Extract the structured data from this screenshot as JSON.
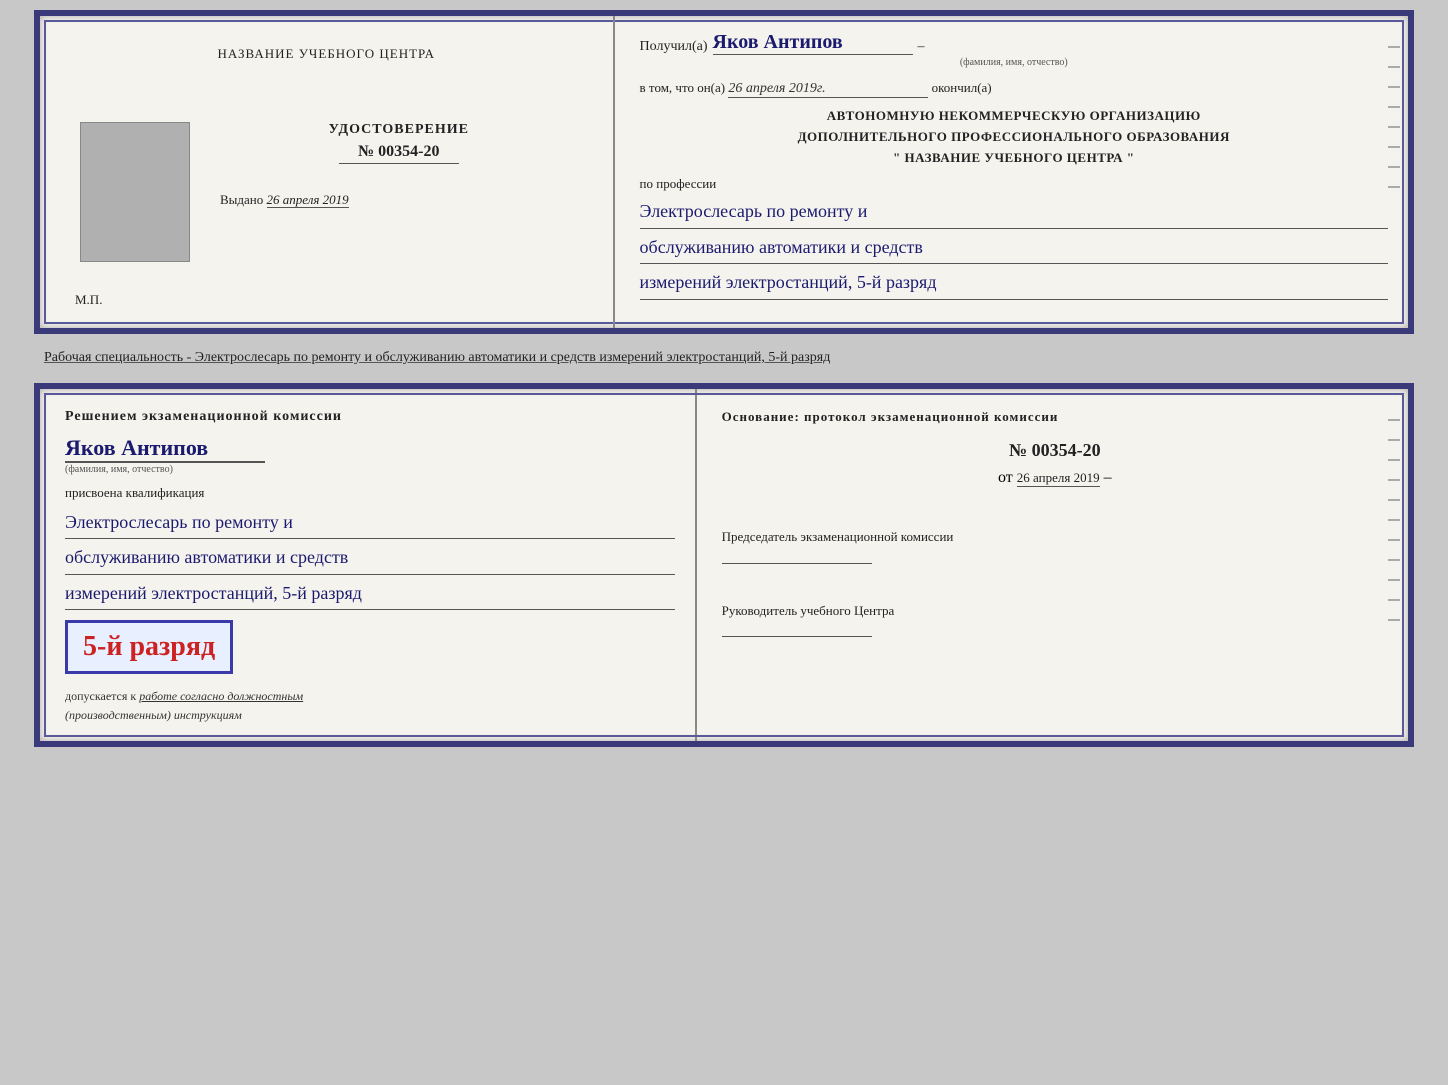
{
  "top": {
    "left": {
      "center_title": "НАЗВАНИЕ УЧЕБНОГО ЦЕНТРА",
      "udostoverenie_label": "УДОСТОВЕРЕНИЕ",
      "number": "№ 00354-20",
      "vydano_label": "Выдано",
      "vydano_date": "26 апреля 2019",
      "mp": "М.П."
    },
    "right": {
      "poluchil_prefix": "Получил(а)",
      "fio_handwritten": "Яков Антипов",
      "fio_sub": "(фамилия, имя, отчество)",
      "vtom_prefix": "в том, что он(а)",
      "vtom_date": "26 апреля 2019г.",
      "okkonchil": "окончил(а)",
      "org_line1": "АВТОНОМНУЮ НЕКОММЕРЧЕСКУЮ ОРГАНИЗАЦИЮ",
      "org_line2": "ДОПОЛНИТЕЛЬНОГО ПРОФЕССИОНАЛЬНОГО ОБРАЗОВАНИЯ",
      "org_line3": "\"  НАЗВАНИЕ УЧЕБНОГО ЦЕНТРА  \"",
      "po_professii": "по профессии",
      "profession_line1": "Электрослесарь по ремонту и",
      "profession_line2": "обслуживанию автоматики и средств",
      "profession_line3": "измерений электростанций, 5-й разряд"
    }
  },
  "middle_text": "Рабочая специальность - Электрослесарь по ремонту и обслуживанию автоматики и средств измерений электростанций, 5-й разряд",
  "bottom": {
    "left": {
      "resheniem_title": "Решением  экзаменационной  комиссии",
      "fio_handwritten": "Яков Антипов",
      "fio_sub": "(фамилия, имя, отчество)",
      "prisvoena_label": "присвоена квалификация",
      "profession_line1": "Электрослесарь по ремонту и",
      "profession_line2": "обслуживанию автоматики и средств",
      "profession_line3": "измерений электростанций, 5-й разряд",
      "grade_badge": "5-й разряд",
      "dopuskaetsya": "допускается к",
      "dopuskaetsya_underline": "работе согласно должностным",
      "dopuskaetsya2": "(производственным) инструкциям"
    },
    "right": {
      "osnovanie_label": "Основание: протокол  экзаменационной  комиссии",
      "number": "№  00354-20",
      "ot_prefix": "от",
      "ot_date": "26 апреля 2019",
      "predsedatel_label": "Председатель экзаменационной комиссии",
      "rukovoditel_label": "Руководитель учебного Центра"
    }
  }
}
